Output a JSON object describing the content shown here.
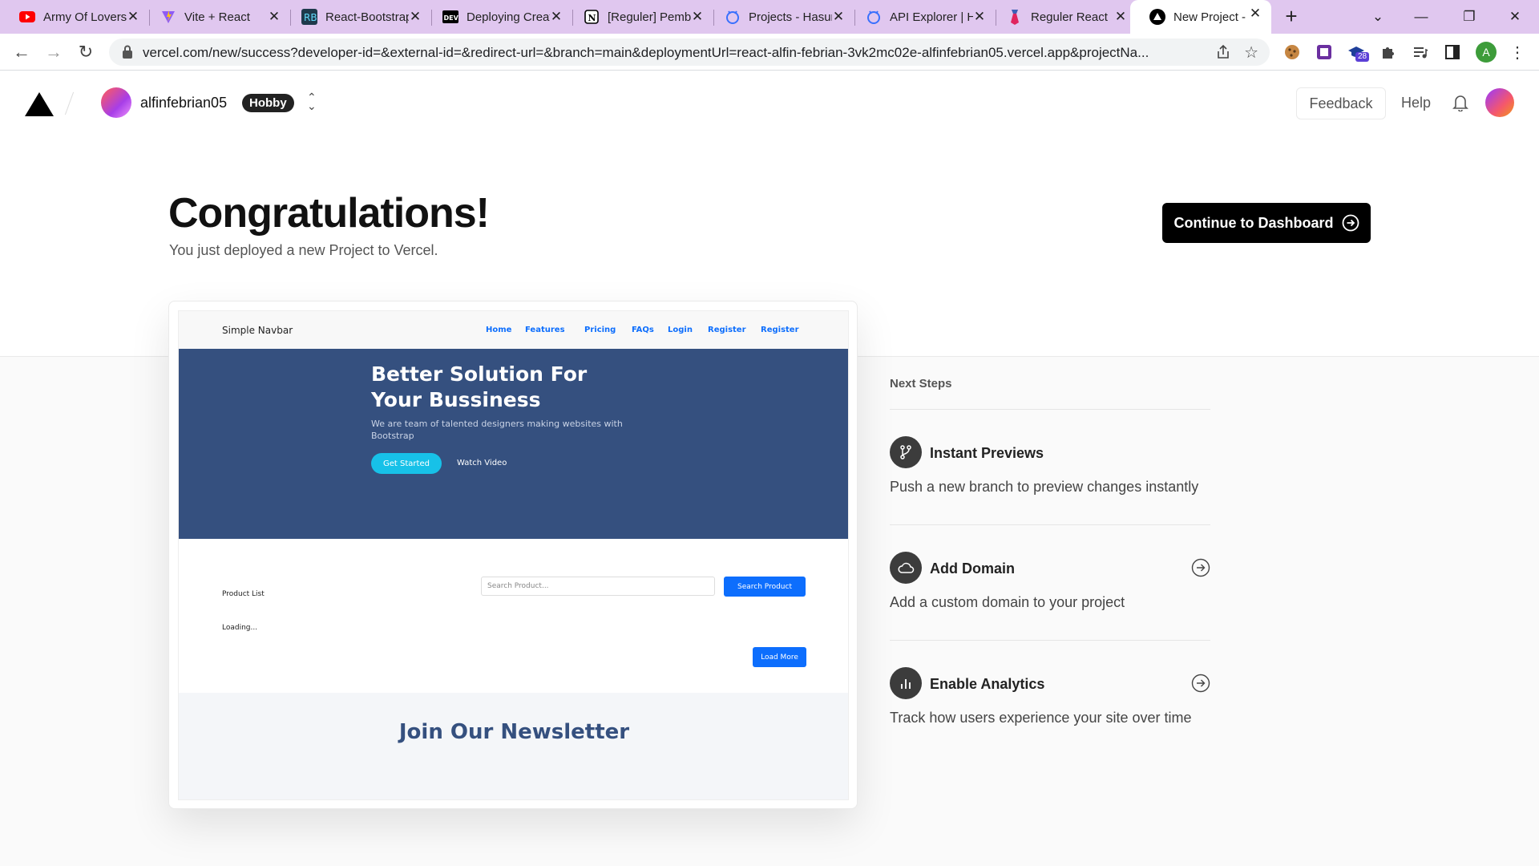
{
  "browser": {
    "tabs": [
      {
        "title": "Army Of Lovers",
        "favicon": "youtube-icon"
      },
      {
        "title": "Vite + React",
        "favicon": "vite-icon"
      },
      {
        "title": "React-Bootstrap",
        "favicon": "react-bootstrap-icon"
      },
      {
        "title": "Deploying Create",
        "favicon": "dev-icon"
      },
      {
        "title": "[Reguler] Pemb",
        "favicon": "notion-icon"
      },
      {
        "title": "Projects - Hasura",
        "favicon": "hasura-icon"
      },
      {
        "title": "API Explorer | H",
        "favicon": "hasura-icon"
      },
      {
        "title": "Reguler React",
        "favicon": "tie-icon"
      },
      {
        "title": "New Project - Vercel",
        "favicon": "vercel-icon"
      }
    ],
    "active_tab": 8,
    "url": "vercel.com/new/success?developer-id=&external-id=&redirect-url=&branch=main&deploymentUrl=react-alfin-febrian-3vk2mc02e-alfinfebrian05.vercel.app&projectNa...",
    "profile_initial": "A",
    "extension_badge": "28"
  },
  "header": {
    "team_name": "alfinfebrian05",
    "plan": "Hobby",
    "feedback": "Feedback",
    "help": "Help"
  },
  "main": {
    "title": "Congratulations!",
    "subtitle": "You just deployed a new Project to Vercel.",
    "continue_button": "Continue to Dashboard"
  },
  "preview": {
    "brand": "Simple Navbar",
    "nav_links": [
      "Home",
      "Features",
      "Pricing",
      "FAQs",
      "Login",
      "Register",
      "Register"
    ],
    "hero_title": "Better Solution For Your Bussiness",
    "hero_text": "We are team of talented designers making websites with Bootstrap",
    "get_started": "Get Started",
    "watch_video": "Watch Video",
    "product_list": "Product List",
    "search_placeholder": "Search Product...",
    "search_button": "Search Product",
    "loading": "Loading...",
    "load_more": "Load More",
    "newsletter_title": "Join Our Newsletter"
  },
  "next_steps": {
    "heading": "Next Steps",
    "items": [
      {
        "title": "Instant Previews",
        "description": "Push a new branch to preview changes instantly",
        "icon": "git-branch-icon"
      },
      {
        "title": "Add Domain",
        "description": "Add a custom domain to your project",
        "icon": "cloud-icon"
      },
      {
        "title": "Enable Analytics",
        "description": "Track how users experience your site over time",
        "icon": "analytics-icon"
      }
    ]
  },
  "colors": {
    "tabstrip": "#e0c7ef",
    "hero": "#35507f",
    "primary_button": "#0d6efd",
    "cta": "#17c1e8"
  }
}
